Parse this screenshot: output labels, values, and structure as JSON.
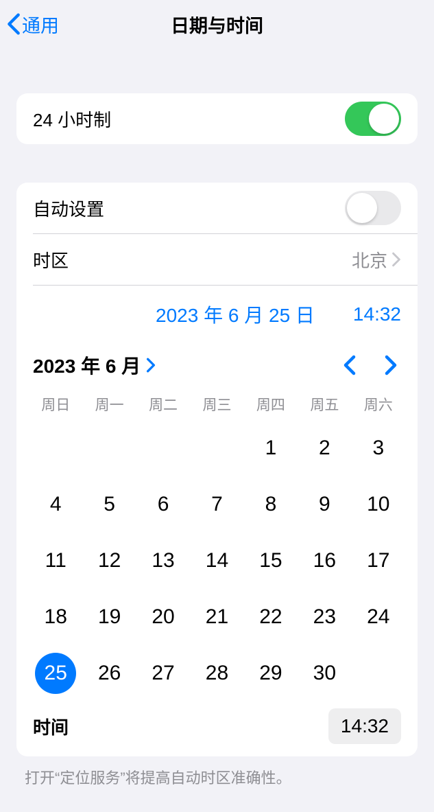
{
  "nav": {
    "back_label": "通用",
    "title": "日期与时间"
  },
  "section1": {
    "twenty_four_hour_label": "24 小时制",
    "twenty_four_hour_on": true
  },
  "section2": {
    "auto_set_label": "自动设置",
    "auto_set_on": false,
    "timezone_label": "时区",
    "timezone_value": "北京",
    "date_display": "2023 年 6 月 25 日",
    "time_display": "14:32",
    "month_label": "2023 年 6 月",
    "weekdays": [
      "周日",
      "周一",
      "周二",
      "周三",
      "周四",
      "周五",
      "周六"
    ],
    "leading_blanks": 4,
    "days_in_month": 30,
    "selected_day": 25,
    "time_row_label": "时间",
    "time_row_value": "14:32"
  },
  "footer": {
    "note": "打开“定位服务”将提高自动时区准确性。"
  }
}
